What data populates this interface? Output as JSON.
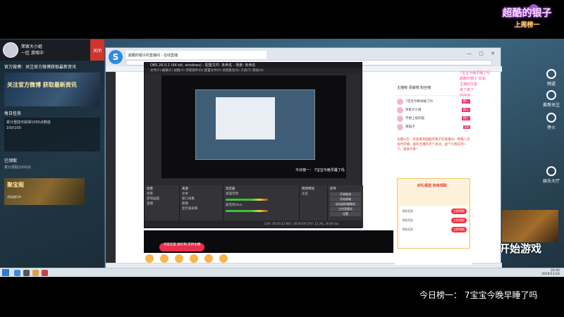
{
  "overlay": {
    "streamer_name": "超酷的银子",
    "streamer_sub": "上周榜一",
    "caption": "今日榜一： 7宝宝今晚早睡了吗",
    "side_buttons": [
      "频道",
      "推荐关注",
      "停火",
      "娱乐大厅"
    ],
    "start_game": "开始游戏",
    "chat_lines": [
      "7宝宝今晚早睡了吗",
      "超酷的银子 加油",
      "主播好厉害",
      "来了来了",
      "冲冲冲"
    ]
  },
  "game_panel": {
    "user": "荣家大小姐",
    "user_sub": "一区 游戏中",
    "close_label": "关闭",
    "notice": "官方微博：关注官方微博获取最新资讯",
    "banner_text": "关注官方微博\n获取最新资讯",
    "task_title": "每日任务",
    "task_detail": "累计登陆可获得1000点数值",
    "task_progress": "100/100",
    "done_title": "已领取",
    "done_sub": "累计领取2000点",
    "banner2_title": "聚宝阁",
    "banner2_sub": "活动进行中"
  },
  "browser": {
    "tab_title": "超酷的银子的直播间 - 在线直播",
    "controls": "— ▢ ✕"
  },
  "obs": {
    "title": "OBS 26.0.2 (64-bit, windows) - 配置文件: 未命名 - 场景: 未命名",
    "menu": "文件(F)  编辑(E)  视图(V)  停靠部件(D)  配置文件(P)  场景集合(S)  工具(T)  帮助(H)",
    "scene_caption": "今日榜一： 7宝宝今晚早睡了吗",
    "panels": {
      "scenes_title": "场景",
      "scenes": [
        "场景",
        "游戏画面",
        "直播"
      ],
      "sources_title": "来源",
      "sources": [
        "文本",
        "窗口采集",
        "图像",
        "显示器采集"
      ],
      "mixer_title": "混音器",
      "mixer": [
        "桌面音频",
        "麦克风/Aux"
      ],
      "transitions_title": "转场特效",
      "transition_value": "淡出",
      "controls_title": "控件",
      "controls": [
        "开始推流",
        "开始录制",
        "启动虚拟摄像机",
        "工作室模式",
        "设置",
        "退出"
      ]
    },
    "status": "LIVE: 00:45:12   REC: 00:00:00   CPU: 12.3%, 30.00 fps"
  },
  "live_panel": {
    "header": "主播榜  贡献榜  粉丝榜",
    "rank": [
      {
        "name": "7宝宝今晚早睡了吗",
        "tag": "榜一"
      },
      {
        "name": "荣家大小姐",
        "tag": "榜二"
      },
      {
        "name": "不想上班的猫",
        "tag": "榜三"
      },
      {
        "name": "夜猫子",
        "tag": "VIP"
      }
    ],
    "announcement": "主播公告：欢迎来到超酷的银子的直播间，每晚八点准时开播，喜欢主播的点个关注，送个礼物支持一下，感谢大家！",
    "promo_title": "好礼相送 快来领取",
    "claims": [
      "领取奖励",
      "领取奖励",
      "领取奖励"
    ],
    "claim_label": "立即领取"
  },
  "bottom": {
    "pill": "点击这里 送礼物 支持主播"
  },
  "taskbar": {
    "time": "20:45",
    "date": "2020/11/24"
  }
}
